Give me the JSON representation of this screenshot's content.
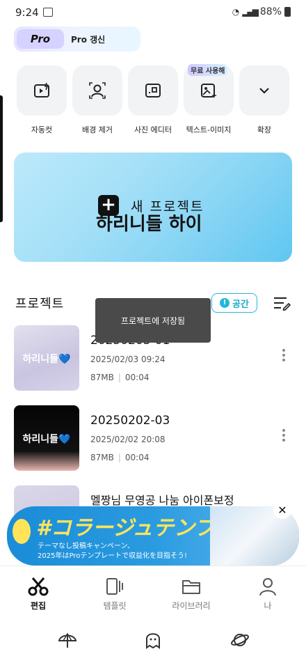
{
  "status": {
    "time": "9:24",
    "battery": "88%"
  },
  "pro": {
    "badge": "Pro",
    "label": "Pro 갱신"
  },
  "tools": [
    {
      "label": "자동컷",
      "icon": "auto-cut-icon"
    },
    {
      "label": "배경 제거",
      "icon": "remove-background-icon"
    },
    {
      "label": "사진 에디터",
      "icon": "photo-editor-icon"
    },
    {
      "label": "텍스트-이미지",
      "icon": "text-to-image-icon",
      "tag": "무료 사용해"
    },
    {
      "label": "확장",
      "icon": "chevron-down-icon"
    }
  ],
  "hero": {
    "title": "새 프로젝트",
    "subtitle": "하리니들 하이"
  },
  "projects_section": {
    "title": "프로젝트",
    "space_button": "공간"
  },
  "toast": "프로젝트에 저장됨",
  "projects": [
    {
      "name": "20250203-01",
      "date": "2025/02/03 09:24",
      "size": "87MB",
      "duration": "00:04",
      "thumb_text": "하리니들",
      "thumb_heart": "💙"
    },
    {
      "name": "20250202-03",
      "date": "2025/02/02 20:08",
      "size": "87MB",
      "duration": "00:04",
      "thumb_text": "하리니들",
      "thumb_heart": "💙"
    },
    {
      "name": "멜짱님 무영공 나눔 아이폰보정",
      "date": "",
      "size": "",
      "duration": ""
    }
  ],
  "ad": {
    "headline": "#コラージュテンプレ",
    "line1": "テーマなし投稿キャンペーン、",
    "line2": "2025年はProテンプレートで収益化を目指そう!"
  },
  "tabs": [
    {
      "label": "편집",
      "icon": "scissors-icon",
      "active": true
    },
    {
      "label": "템플릿",
      "icon": "template-icon",
      "active": false
    },
    {
      "label": "라이브러리",
      "icon": "folder-icon",
      "active": false
    },
    {
      "label": "나",
      "icon": "person-icon",
      "active": false
    }
  ],
  "colors": {
    "accent": "#22b8d8",
    "hero_start": "#bde9fb",
    "hero_end": "#5fc7f1",
    "pro_badge": "#d6d2ff",
    "toast": "#4a4a4a",
    "ad_blue": "#1a8cd8",
    "ad_yellow": "#ffe45a"
  }
}
